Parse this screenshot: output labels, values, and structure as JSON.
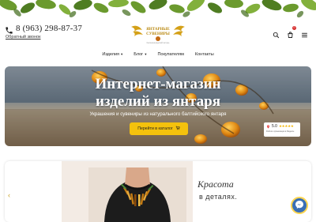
{
  "header": {
    "phone": "8 (963) 298-87-37",
    "callback_link": "Обратный звонок",
    "logo_line1": "ЯНТАРНЫЕ",
    "logo_line2": "СУВЕНИРЫ",
    "logo_tagline": "Калининградский янтарь",
    "cart_count": "0"
  },
  "nav": {
    "items": [
      {
        "label": "Изделия",
        "has_dropdown": true
      },
      {
        "label": "Блог",
        "has_dropdown": true
      },
      {
        "label": "Покупателям",
        "has_dropdown": false
      },
      {
        "label": "Контакты",
        "has_dropdown": false
      }
    ]
  },
  "hero": {
    "title_line1": "Интернет-магазин",
    "title_line2": "изделий из янтаря",
    "subtitle": "Украшения и сувениры из натурального балтийского янтаря",
    "button_label": "Перейти в каталог",
    "rating_value": "5.0",
    "rating_stars": "★★★★★",
    "rating_caption": "Рейтинг организации в Яндексе"
  },
  "slider": {
    "script_text": "Красота",
    "tagline": "в деталях.",
    "prev_arrow": "‹"
  },
  "icons": {
    "phone": "phone-icon",
    "search": "search-icon",
    "cart": "cart-icon",
    "menu": "hamburger-menu-icon",
    "messenger": "messenger-icon"
  },
  "colors": {
    "accent": "#f4c20d",
    "leaves": "#5a8a2a",
    "amber": "#d98a1c",
    "badge": "#d62828",
    "messenger": "#3a6fb5"
  }
}
